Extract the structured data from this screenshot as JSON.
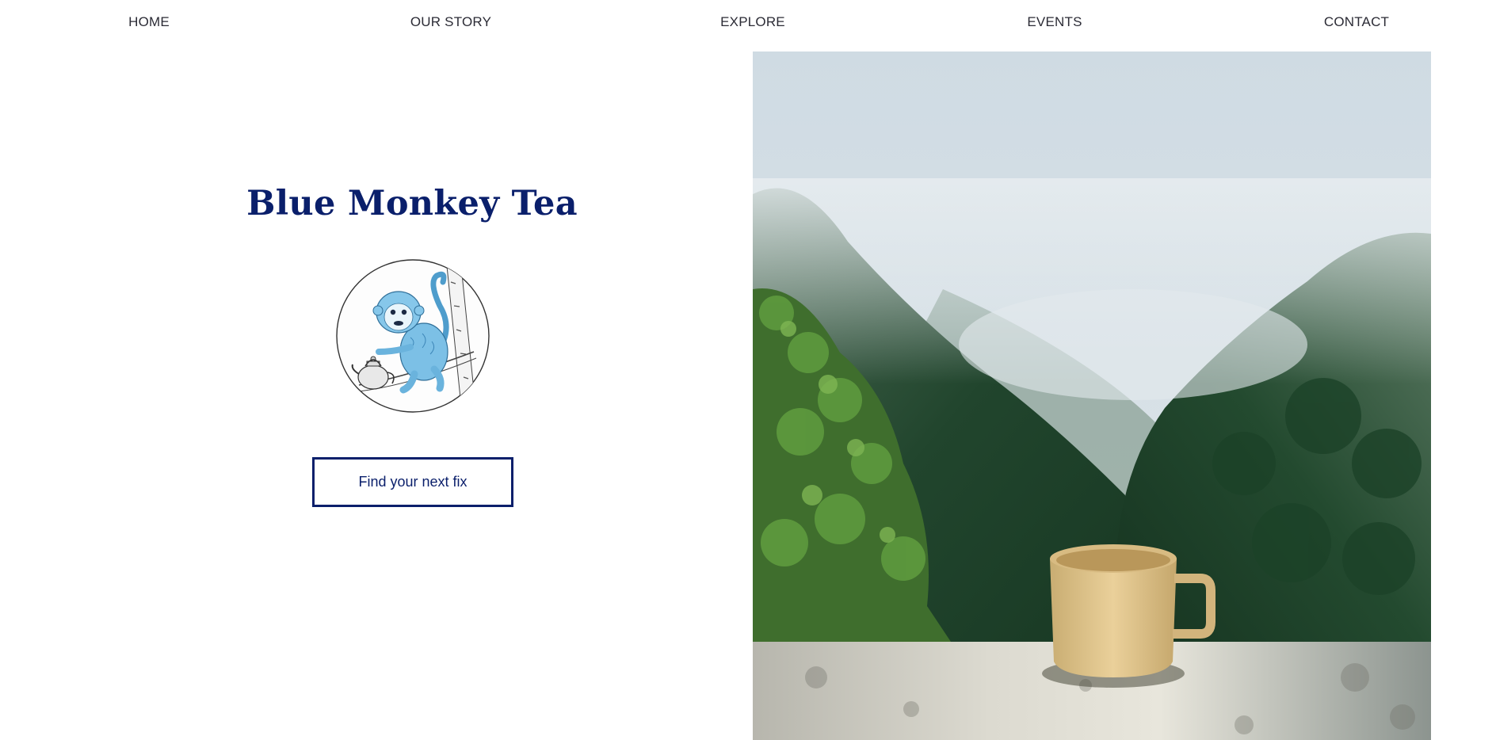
{
  "nav": {
    "items": [
      {
        "label": "HOME"
      },
      {
        "label": "OUR STORY"
      },
      {
        "label": "EXPLORE"
      },
      {
        "label": "EVENTS"
      },
      {
        "label": "CONTACT"
      }
    ]
  },
  "hero": {
    "title": "Blue Monkey Tea",
    "logo_icon": "monkey-with-teapot-illustration",
    "cta_label": "Find your next fix"
  },
  "photo": {
    "subject": "misty-forest-valley-with-tea-cup"
  },
  "colors": {
    "brand_navy": "#0a1f6b",
    "nav_text": "#2b2b35",
    "monkey_blue": "#6fb6de"
  }
}
